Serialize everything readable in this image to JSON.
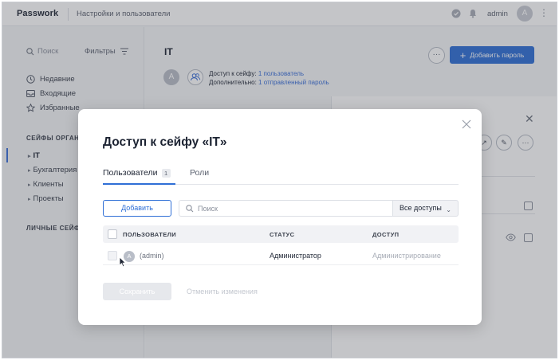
{
  "topbar": {
    "brand": "Passwork",
    "subtitle": "Настройки и пользователи",
    "username": "admin",
    "avatar_letter": "A"
  },
  "sidebar": {
    "search_placeholder": "Поиск",
    "filters_label": "Фильтры",
    "nav": [
      {
        "label": "Недавние",
        "icon": "clock-icon"
      },
      {
        "label": "Входящие",
        "icon": "inbox-icon"
      },
      {
        "label": "Избранные",
        "icon": "star-icon"
      }
    ],
    "org_vaults_title": "СЕЙФЫ ОРГАНИ",
    "vaults": [
      {
        "label": "IT",
        "active": true
      },
      {
        "label": "Бухгалтерия"
      },
      {
        "label": "Клиенты"
      },
      {
        "label": "Проекты"
      }
    ],
    "personal_vaults_title": "ЛИЧНЫЕ СЕЙФЫ"
  },
  "main": {
    "title": "IT",
    "avatar_letter": "A",
    "access_label": "Доступ к сейфу:",
    "access_value": "1 пользователь",
    "extra_label": "Дополнительно:",
    "extra_value": "1 отправленный пароль",
    "more_label": "···",
    "add_password_label": "Добавить пароль"
  },
  "modal": {
    "title": "Доступ к сейфу «IT»",
    "tabs": [
      {
        "label": "Пользователи",
        "count": "1",
        "active": true
      },
      {
        "label": "Роли",
        "active": false
      }
    ],
    "add_button": "Добавить",
    "search_placeholder": "Поиск",
    "access_filter": "Все доступы",
    "columns": {
      "users": "ПОЛЬЗОВАТЕЛИ",
      "status": "СТАТУС",
      "access": "ДОСТУП"
    },
    "rows": [
      {
        "avatar_letter": "A",
        "name": "(admin)",
        "status": "Администратор",
        "access": "Администрирование"
      }
    ],
    "save_button": "Сохранить",
    "cancel_link": "Отменить изменения"
  },
  "colors": {
    "accent": "#2f6fd6",
    "overlay": "#3c4048"
  }
}
